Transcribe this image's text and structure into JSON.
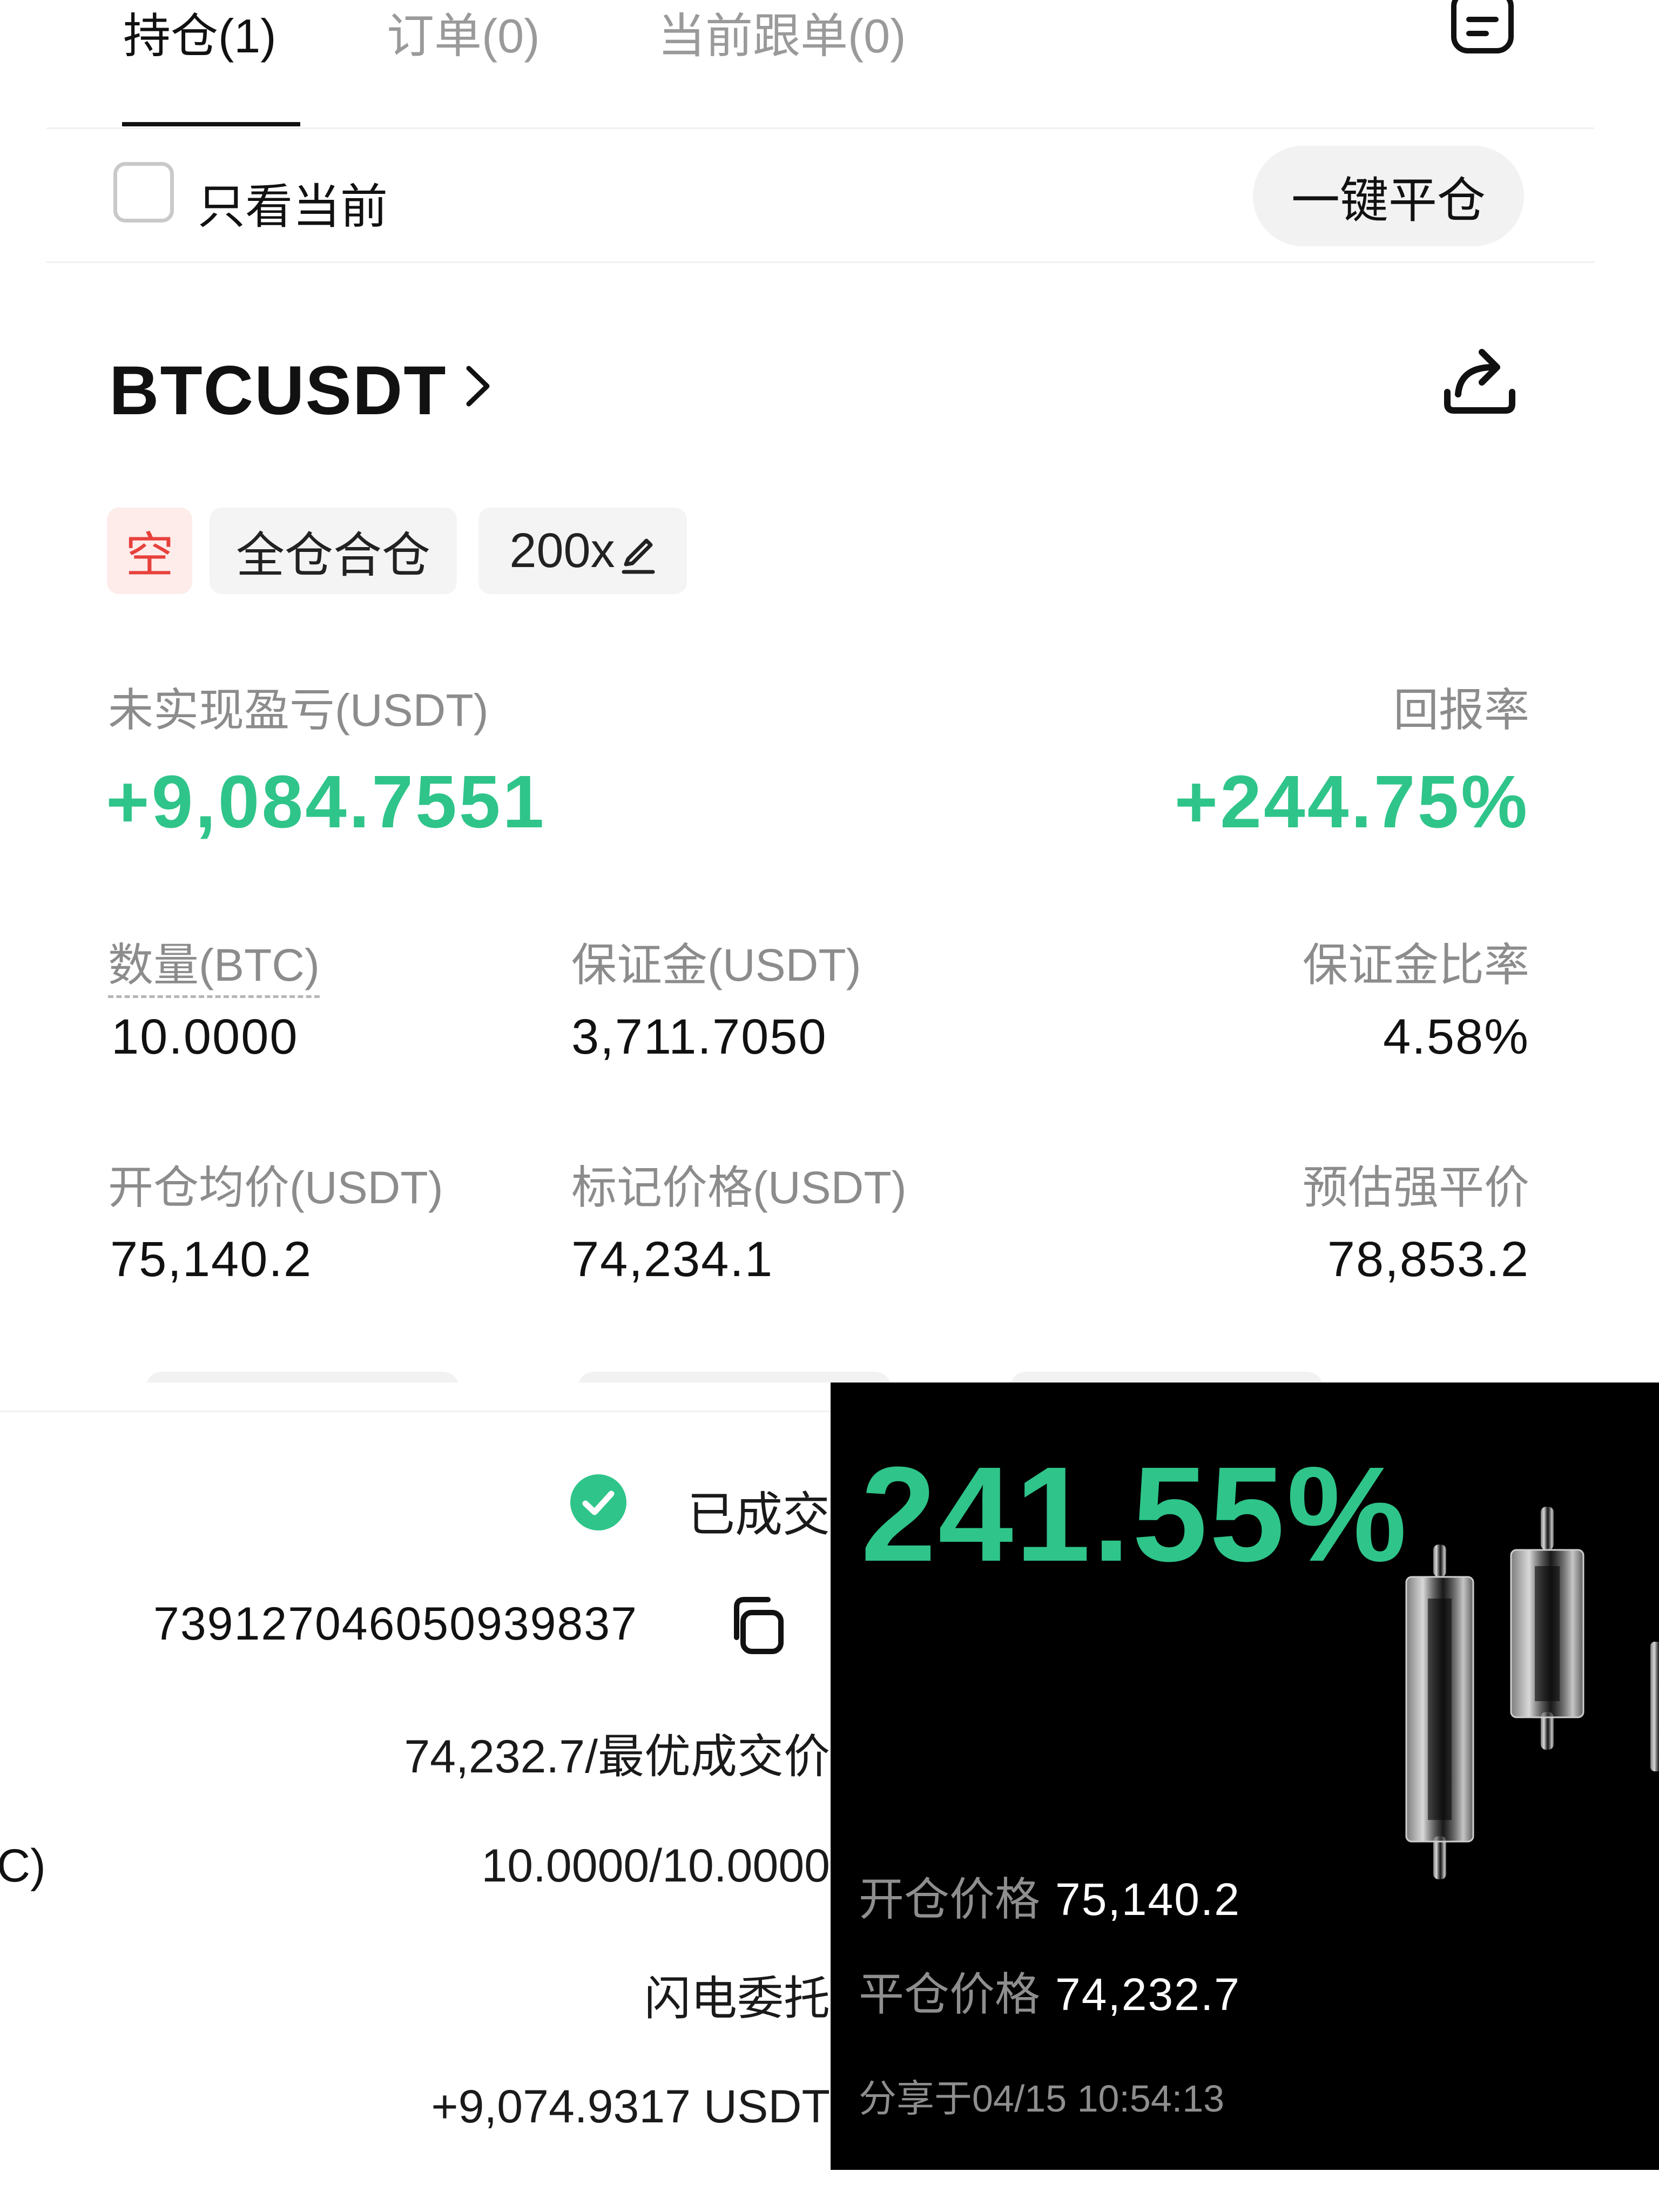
{
  "tabs": [
    {
      "label": "持仓(1)",
      "active": true
    },
    {
      "label": "订单(0)",
      "active": false
    },
    {
      "label": "当前跟单(0)",
      "active": false
    }
  ],
  "filter": {
    "checkbox_label": "只看当前",
    "checked": false
  },
  "close_all_button": "一键平仓",
  "position": {
    "symbol": "BTCUSDT",
    "side_tag": "空",
    "margin_mode": "全仓合仓",
    "leverage": "200x",
    "pnl_label": "未实现盈亏(USDT)",
    "pnl_value": "+9,084.7551",
    "roi_label": "回报率",
    "roi_value": "+244.75%",
    "qty_label": "数量(BTC)",
    "qty_value": "10.0000",
    "margin_label": "保证金(USDT)",
    "margin_value": "3,711.7050",
    "margin_ratio_label": "保证金比率",
    "margin_ratio_value": "4.58%",
    "entry_label": "开仓均价(USDT)",
    "entry_value": "75,140.2",
    "mark_label": "标记价格(USDT)",
    "mark_value": "74,234.1",
    "liq_label": "预估强平价",
    "liq_value": "78,853.2"
  },
  "order_detail": {
    "status": "已成交",
    "order_id": "739127046050939837",
    "price": "74,232.7/最优成交价",
    "partial_label": "C)",
    "filled": "10.0000/10.0000",
    "order_type": "闪电委托",
    "pnl": "+9,074.9317 USDT"
  },
  "share_card": {
    "roi": "241.55%",
    "open_label": "开仓价格",
    "open_value": "75,140.2",
    "close_label": "平仓价格",
    "close_value": "74,232.7",
    "shared_at": "分享于04/15 10:54:13"
  },
  "colors": {
    "profit_green": "#2fc48a",
    "short_red": "#e8413c",
    "short_red_bg": "#fdecea"
  }
}
